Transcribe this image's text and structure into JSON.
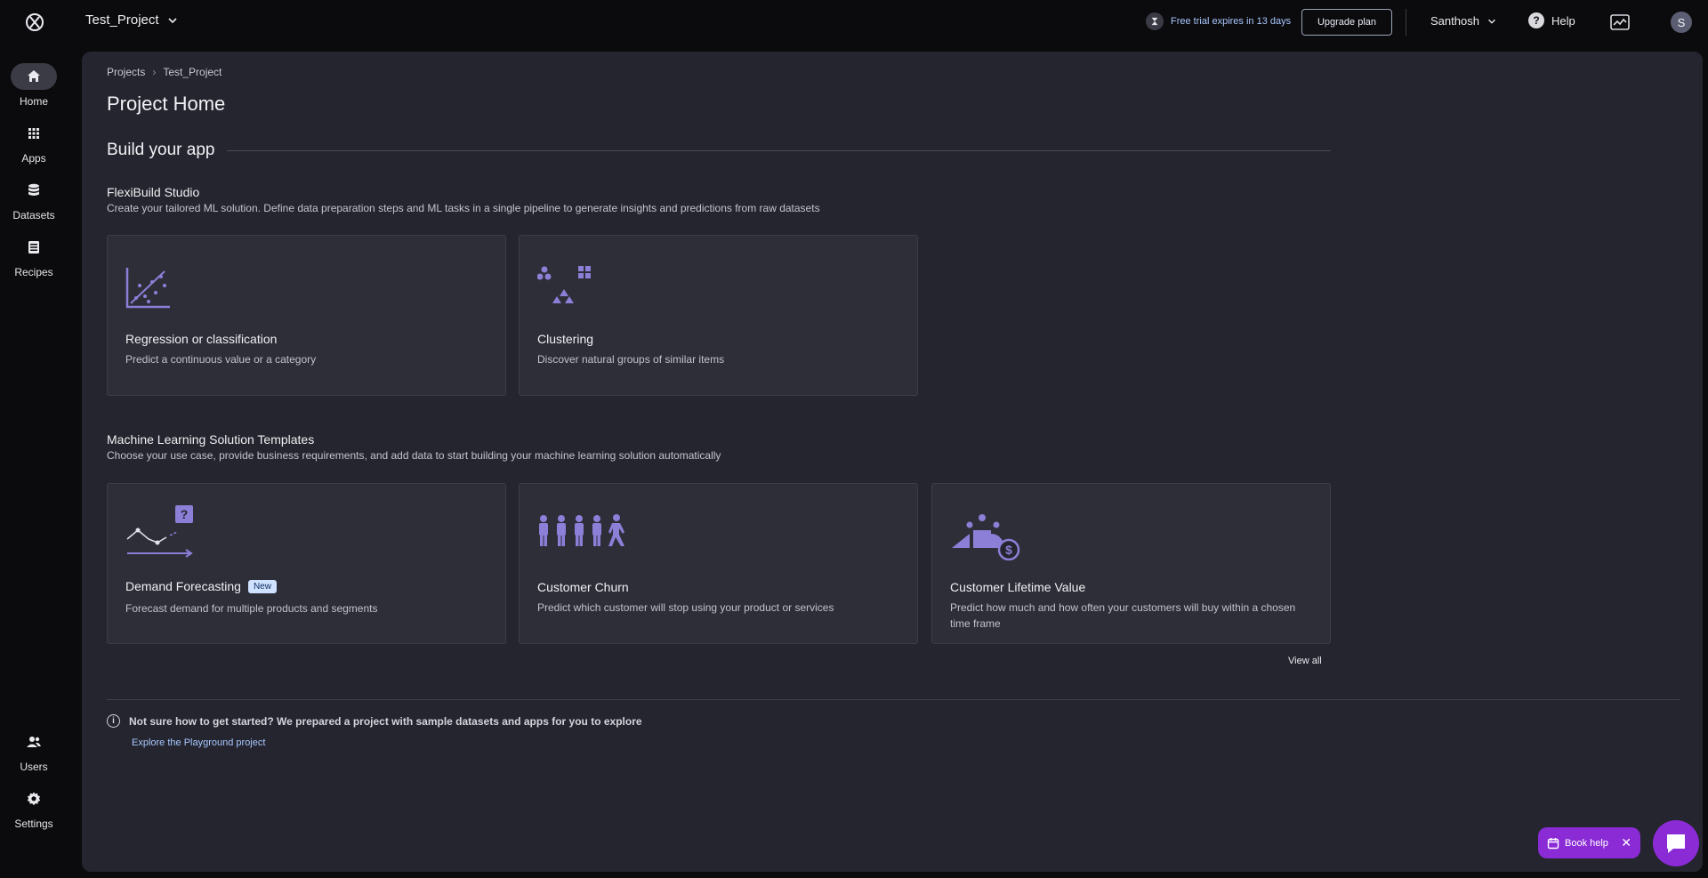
{
  "topbar": {
    "project_name": "Test_Project",
    "trial_text": "Free trial expires in 13 days",
    "upgrade_label": "Upgrade plan",
    "user_name": "Santhosh",
    "help_label": "Help",
    "avatar_initial": "S"
  },
  "sidenav": {
    "items": [
      {
        "label": "Home",
        "icon": "home-icon"
      },
      {
        "label": "Apps",
        "icon": "grid-icon"
      },
      {
        "label": "Datasets",
        "icon": "database-icon"
      },
      {
        "label": "Recipes",
        "icon": "list-icon"
      },
      {
        "label": "Users",
        "icon": "users-icon"
      },
      {
        "label": "Settings",
        "icon": "gear-icon"
      }
    ]
  },
  "main": {
    "breadcrumb": [
      "Projects",
      "Test_Project"
    ],
    "page_title": "Project Home",
    "section_title": "Build your app",
    "flexibuild": {
      "title": "FlexiBuild Studio",
      "desc": "Create your tailored ML solution. Define data preparation steps and ML tasks in a single pipeline to generate insights and predictions from raw datasets",
      "cards": [
        {
          "title": "Regression or classification",
          "desc": "Predict a continuous value or a category"
        },
        {
          "title": "Clustering",
          "desc": "Discover natural groups of similar items"
        }
      ]
    },
    "templates": {
      "title": "Machine Learning Solution Templates",
      "desc": "Choose your use case, provide business requirements, and add data to start building your machine learning solution automatically",
      "cards": [
        {
          "title": "Demand Forecasting",
          "badge": "New",
          "desc": "Forecast demand for multiple products and segments"
        },
        {
          "title": "Customer Churn",
          "desc": "Predict which customer will stop using your product or services"
        },
        {
          "title": "Customer Lifetime Value",
          "desc": "Predict how much and how often your customers will buy within a chosen time frame"
        }
      ]
    },
    "view_all": "View all",
    "info_text": "Not sure how to get started? We prepared a project with sample datasets and apps for you to explore",
    "explore_link": "Explore the Playground project"
  },
  "floating": {
    "book_help": "Book help",
    "close": "✕"
  },
  "colors": {
    "accent_purple": "#8a2bd6",
    "link_blue": "#a9c7ff",
    "icon_purple": "#8b7fd8"
  }
}
